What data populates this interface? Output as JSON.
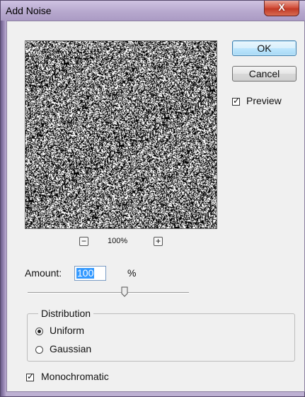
{
  "window": {
    "title": "Add Noise",
    "close_glyph": "X"
  },
  "preview": {
    "zoom_out_glyph": "−",
    "zoom_in_glyph": "+",
    "zoom_level": "100%"
  },
  "buttons": {
    "ok": "OK",
    "cancel": "Cancel"
  },
  "preview_toggle": {
    "label": "Preview",
    "checked": true
  },
  "amount": {
    "label": "Amount:",
    "value": "100",
    "unit": "%",
    "slider_fraction": 0.58
  },
  "distribution": {
    "legend": "Distribution",
    "options": [
      {
        "label": "Uniform",
        "selected": true
      },
      {
        "label": "Gaussian",
        "selected": false
      }
    ]
  },
  "monochromatic": {
    "label": "Monochromatic",
    "checked": true
  },
  "icons": {
    "close": "close-icon",
    "zoom_out": "minus-icon",
    "zoom_in": "plus-icon",
    "check": "checkmark-icon"
  },
  "colors": {
    "title_bar": "#b7a8ce",
    "close_button": "#c23a26",
    "selection": "#3399ff",
    "dialog_bg": "#f0f0f0"
  }
}
